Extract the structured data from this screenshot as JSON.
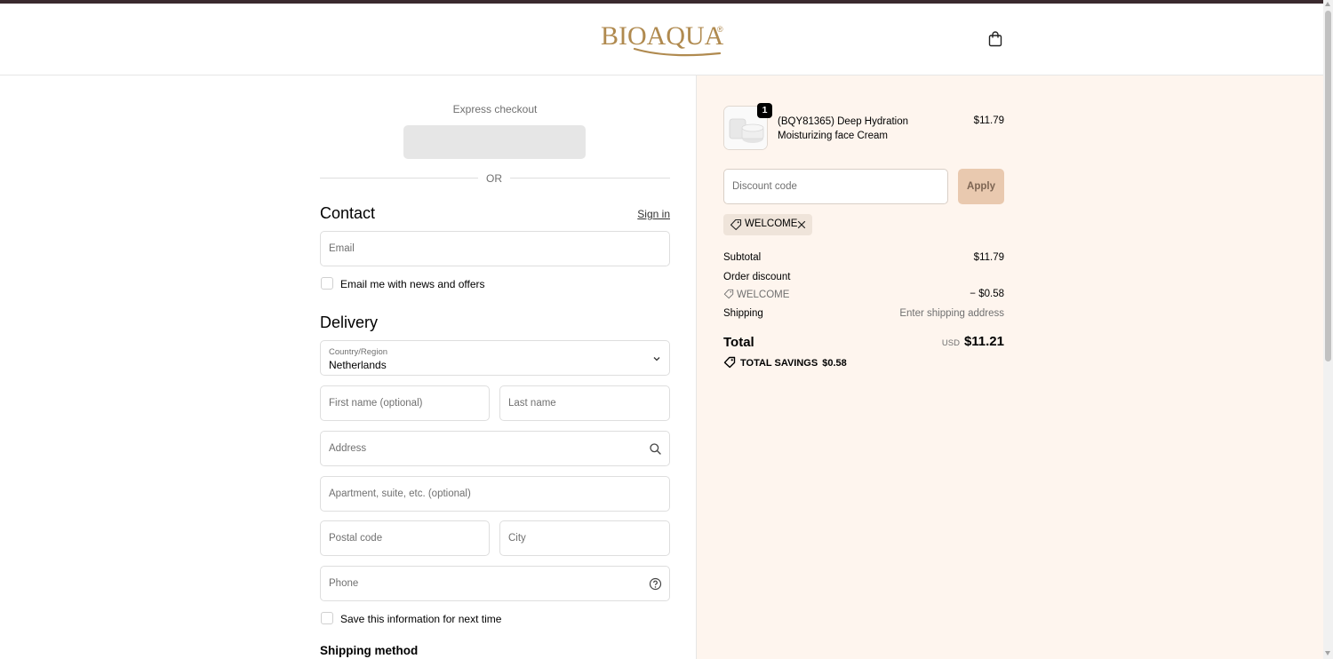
{
  "header": {
    "logo_text": "BIOAQUA",
    "logo_reg": "®"
  },
  "express": {
    "title": "Express checkout",
    "or_label": "OR"
  },
  "contact": {
    "title": "Contact",
    "sign_in_label": "Sign in",
    "email_placeholder": "Email",
    "newsletter_label": "Email me with news and offers"
  },
  "delivery": {
    "title": "Delivery",
    "country_label": "Country/Region",
    "country_value": "Netherlands",
    "first_name_placeholder": "First name (optional)",
    "last_name_placeholder": "Last name",
    "address_placeholder": "Address",
    "apartment_placeholder": "Apartment, suite, etc. (optional)",
    "postal_placeholder": "Postal code",
    "city_placeholder": "City",
    "phone_placeholder": "Phone",
    "save_info_label": "Save this information for next time",
    "shipping_method_title": "Shipping method"
  },
  "summary": {
    "item": {
      "quantity": "1",
      "name": "(BQY81365) Deep Hydration Moisturizing face Cream",
      "price": "$11.79"
    },
    "discount_placeholder": "Discount code",
    "apply_label": "Apply",
    "applied_code": "WELCOME",
    "subtotal_label": "Subtotal",
    "subtotal_value": "$11.79",
    "order_discount_label": "Order discount",
    "discount_code_label": "WELCOME",
    "discount_value": "− $0.58",
    "shipping_label": "Shipping",
    "shipping_value": "Enter shipping address",
    "total_label": "Total",
    "currency": "USD",
    "total_value": "$11.21",
    "savings_label": "TOTAL SAVINGS",
    "savings_value": "$0.58"
  },
  "colors": {
    "brand_gold": "#b08a4f",
    "summary_bg": "#fef5ee",
    "apply_bg": "#e9c9af",
    "top_bar": "#3a2a2e"
  }
}
